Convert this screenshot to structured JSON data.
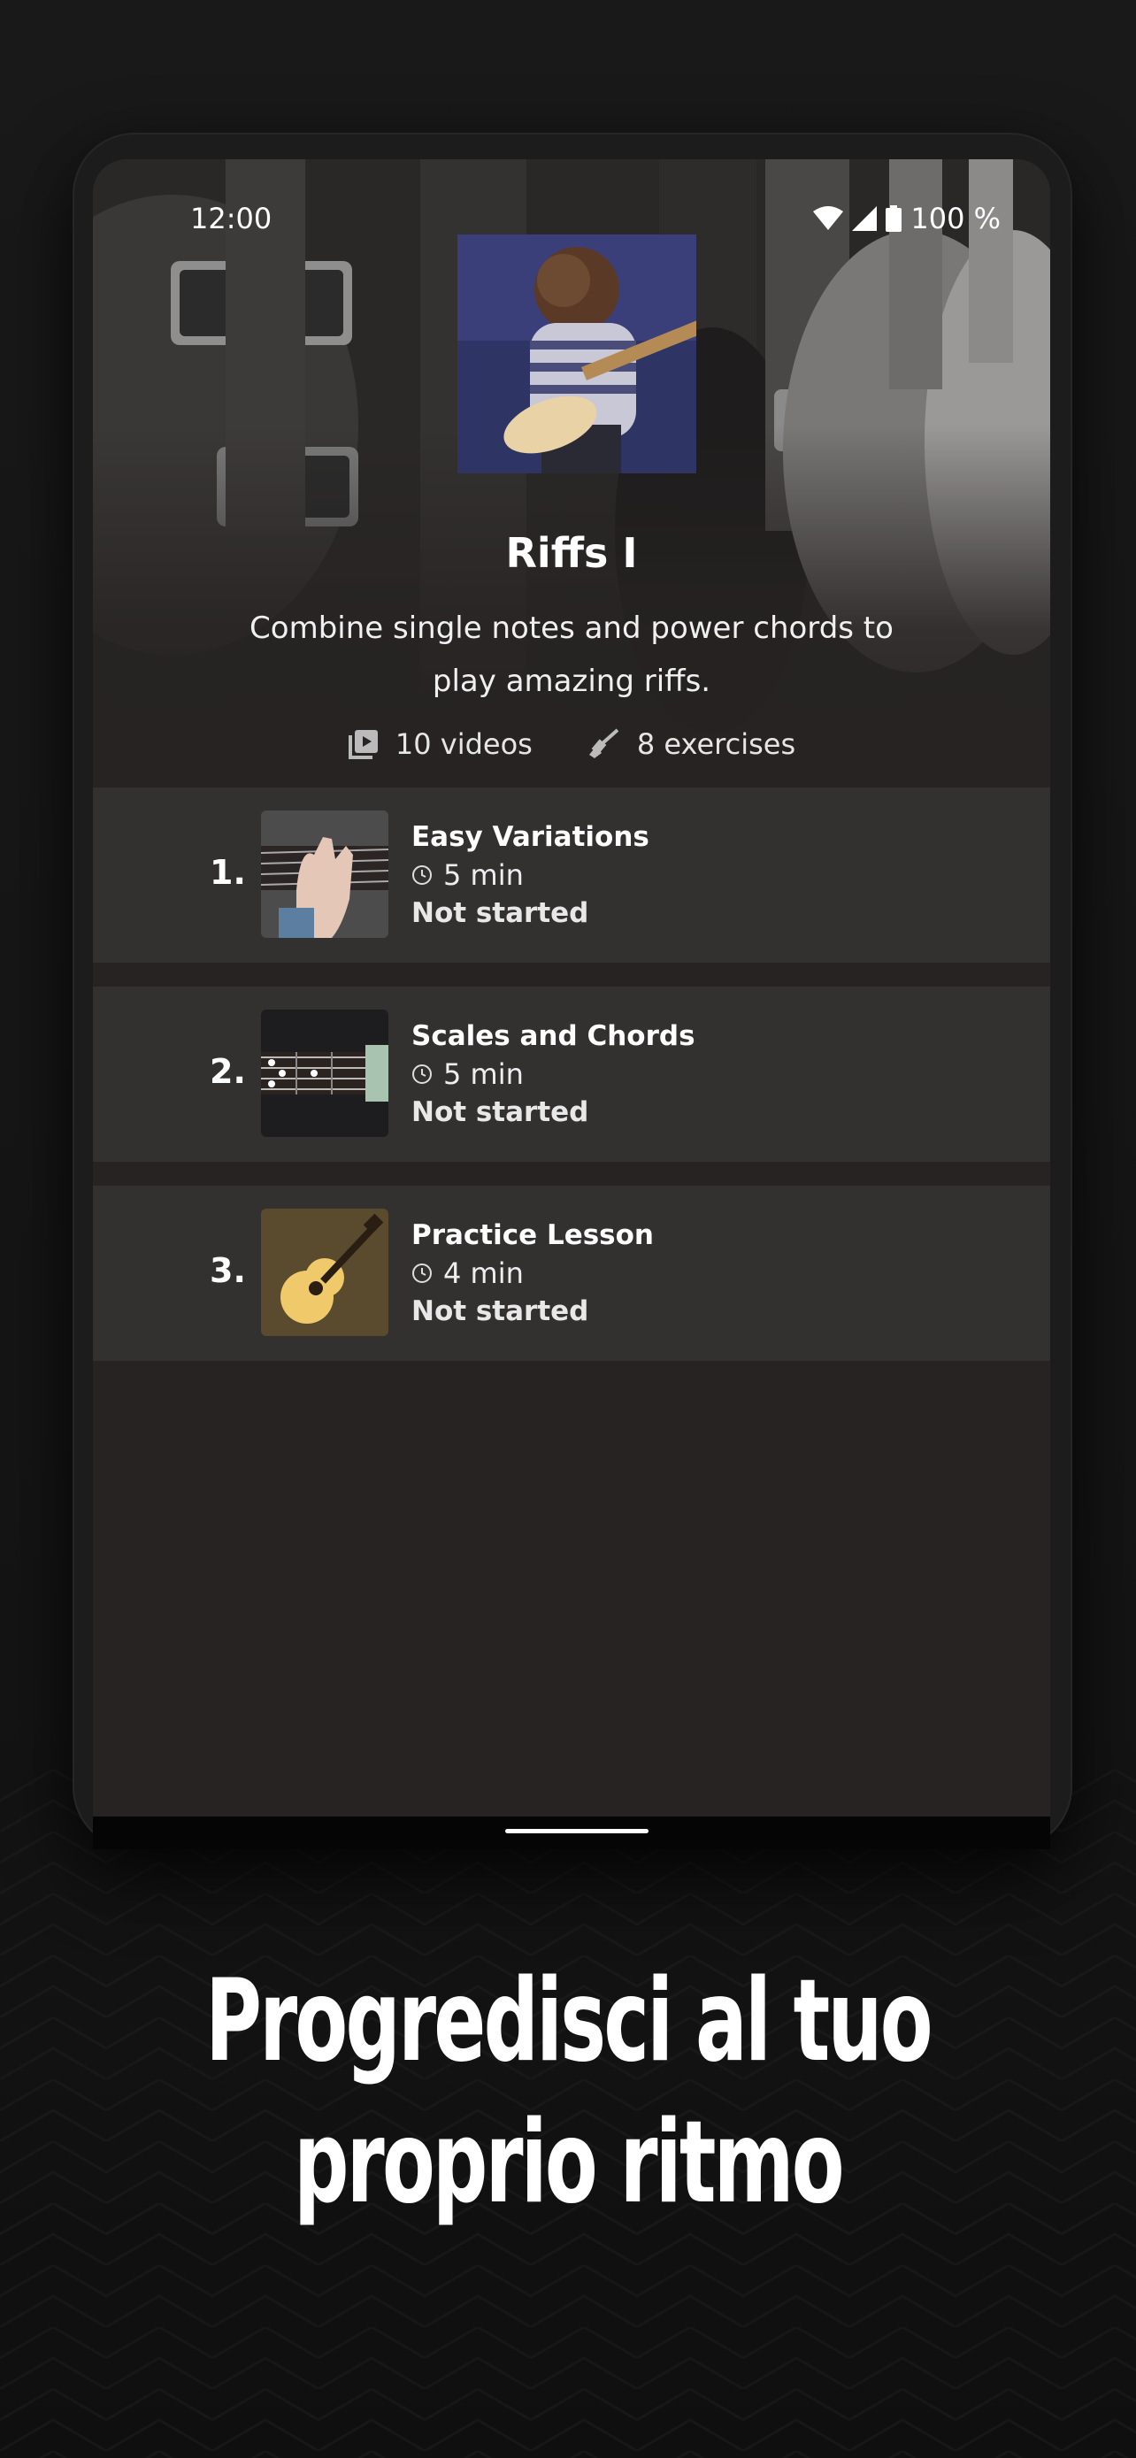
{
  "status_bar": {
    "time": "12:00",
    "battery": "100 %"
  },
  "course": {
    "title": "Riffs I",
    "description": "Combine single notes and power chords to play amazing riffs.",
    "videos": "10 videos",
    "exercises": "8 exercises"
  },
  "lessons": [
    {
      "number": "1.",
      "title": "Easy Variations",
      "duration": "5 min",
      "status": "Not started"
    },
    {
      "number": "2.",
      "title": "Scales and Chords",
      "duration": "5 min",
      "status": "Not started"
    },
    {
      "number": "3.",
      "title": "Practice Lesson",
      "duration": "4 min",
      "status": "Not started"
    }
  ],
  "tagline": {
    "line1": "Progredisci al tuo",
    "line2": "proprio ritmo"
  },
  "colors": {
    "background": "#131313",
    "screen": "#262322",
    "row": "#333130"
  }
}
